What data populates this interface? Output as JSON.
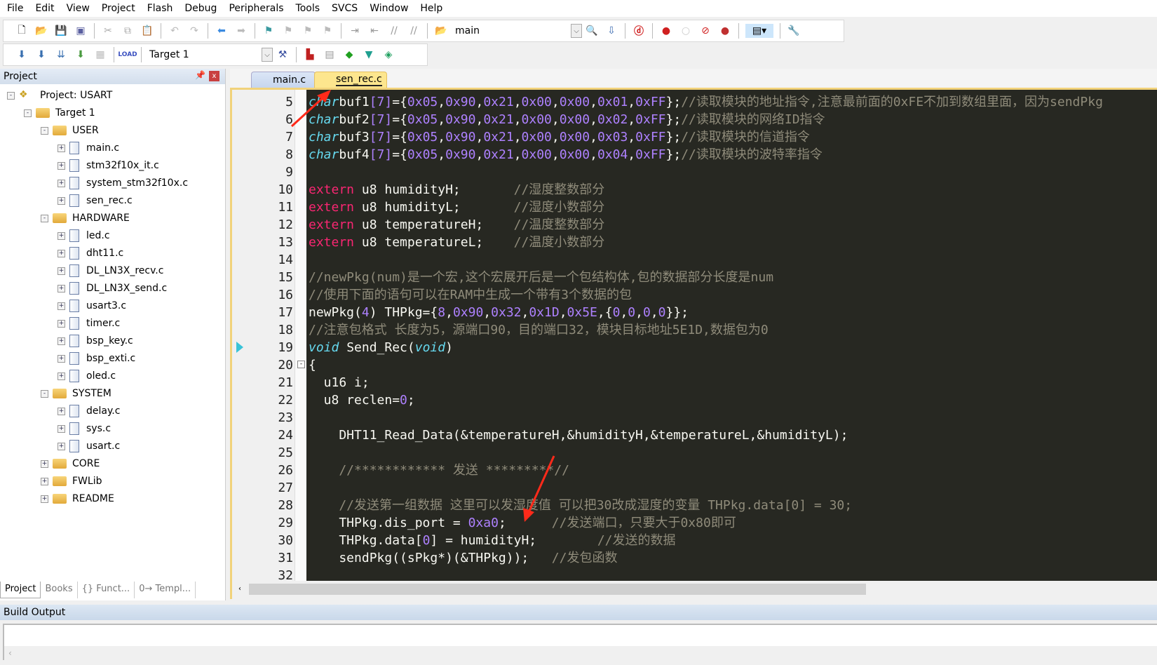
{
  "menu": [
    "File",
    "Edit",
    "View",
    "Project",
    "Flash",
    "Debug",
    "Peripherals",
    "Tools",
    "SVCS",
    "Window",
    "Help"
  ],
  "toolbar1": {
    "combo_value": "main"
  },
  "toolbar2": {
    "target_value": "Target 1"
  },
  "project_panel": {
    "title": "Project",
    "tree": [
      {
        "label": "Project: USART",
        "level": 0,
        "type": "project",
        "exp": "-"
      },
      {
        "label": "Target 1",
        "level": 1,
        "type": "target",
        "exp": "-"
      },
      {
        "label": "USER",
        "level": 2,
        "type": "folder",
        "exp": "-"
      },
      {
        "label": "main.c",
        "level": 3,
        "type": "file",
        "exp": "+"
      },
      {
        "label": "stm32f10x_it.c",
        "level": 3,
        "type": "file",
        "exp": "+"
      },
      {
        "label": "system_stm32f10x.c",
        "level": 3,
        "type": "file",
        "exp": "+"
      },
      {
        "label": "sen_rec.c",
        "level": 3,
        "type": "file",
        "exp": "+"
      },
      {
        "label": "HARDWARE",
        "level": 2,
        "type": "folder",
        "exp": "-"
      },
      {
        "label": "led.c",
        "level": 3,
        "type": "file",
        "exp": "+"
      },
      {
        "label": "dht11.c",
        "level": 3,
        "type": "file",
        "exp": "+"
      },
      {
        "label": "DL_LN3X_recv.c",
        "level": 3,
        "type": "file",
        "exp": "+"
      },
      {
        "label": "DL_LN3X_send.c",
        "level": 3,
        "type": "file",
        "exp": "+"
      },
      {
        "label": "usart3.c",
        "level": 3,
        "type": "file",
        "exp": "+"
      },
      {
        "label": "timer.c",
        "level": 3,
        "type": "file",
        "exp": "+"
      },
      {
        "label": "bsp_key.c",
        "level": 3,
        "type": "file",
        "exp": "+"
      },
      {
        "label": "bsp_exti.c",
        "level": 3,
        "type": "file",
        "exp": "+"
      },
      {
        "label": "oled.c",
        "level": 3,
        "type": "file",
        "exp": "+"
      },
      {
        "label": "SYSTEM",
        "level": 2,
        "type": "folder",
        "exp": "-"
      },
      {
        "label": "delay.c",
        "level": 3,
        "type": "file",
        "exp": "+"
      },
      {
        "label": "sys.c",
        "level": 3,
        "type": "file",
        "exp": "+"
      },
      {
        "label": "usart.c",
        "level": 3,
        "type": "file",
        "exp": "+"
      },
      {
        "label": "CORE",
        "level": 2,
        "type": "folder",
        "exp": "+"
      },
      {
        "label": "FWLib",
        "level": 2,
        "type": "folder",
        "exp": "+"
      },
      {
        "label": "README",
        "level": 2,
        "type": "folder",
        "exp": "+"
      }
    ],
    "tabs": [
      "Project",
      "Books",
      "{} Funct...",
      "0→ Templ..."
    ]
  },
  "editor": {
    "tabs": [
      {
        "label": "main.c",
        "active": false
      },
      {
        "label": "sen_rec.c",
        "active": true
      }
    ],
    "current_line": 19,
    "lines": [
      {
        "n": 5,
        "t": [
          [
            "kw",
            "char"
          ],
          [
            "",
            "buf1"
          ],
          [
            "nu",
            "[7]"
          ],
          [
            "",
            "={"
          ],
          [
            "nu",
            "0x05"
          ],
          [
            "",
            ","
          ],
          [
            "nu",
            "0x90"
          ],
          [
            "",
            ","
          ],
          [
            "nu",
            "0x21"
          ],
          [
            "",
            ","
          ],
          [
            "nu",
            "0x00"
          ],
          [
            "",
            ","
          ],
          [
            "nu",
            "0x00"
          ],
          [
            "",
            ","
          ],
          [
            "nu",
            "0x01"
          ],
          [
            "",
            ","
          ],
          [
            "nu",
            "0xFF"
          ],
          [
            "",
            "};"
          ],
          [
            "cm",
            "//读取模块的地址指令,注意最前面的0xFE不加到数组里面，因为sendPkg"
          ]
        ]
      },
      {
        "n": 6,
        "t": [
          [
            "kw",
            "char"
          ],
          [
            "",
            "buf2"
          ],
          [
            "nu",
            "[7]"
          ],
          [
            "",
            "={"
          ],
          [
            "nu",
            "0x05"
          ],
          [
            "",
            ","
          ],
          [
            "nu",
            "0x90"
          ],
          [
            "",
            ","
          ],
          [
            "nu",
            "0x21"
          ],
          [
            "",
            ","
          ],
          [
            "nu",
            "0x00"
          ],
          [
            "",
            ","
          ],
          [
            "nu",
            "0x00"
          ],
          [
            "",
            ","
          ],
          [
            "nu",
            "0x02"
          ],
          [
            "",
            ","
          ],
          [
            "nu",
            "0xFF"
          ],
          [
            "",
            "};"
          ],
          [
            "cm",
            "//读取模块的网络ID指令"
          ]
        ]
      },
      {
        "n": 7,
        "t": [
          [
            "kw",
            "char"
          ],
          [
            "",
            "buf3"
          ],
          [
            "nu",
            "[7]"
          ],
          [
            "",
            "={"
          ],
          [
            "nu",
            "0x05"
          ],
          [
            "",
            ","
          ],
          [
            "nu",
            "0x90"
          ],
          [
            "",
            ","
          ],
          [
            "nu",
            "0x21"
          ],
          [
            "",
            ","
          ],
          [
            "nu",
            "0x00"
          ],
          [
            "",
            ","
          ],
          [
            "nu",
            "0x00"
          ],
          [
            "",
            ","
          ],
          [
            "nu",
            "0x03"
          ],
          [
            "",
            ","
          ],
          [
            "nu",
            "0xFF"
          ],
          [
            "",
            "};"
          ],
          [
            "cm",
            "//读取模块的信道指令"
          ]
        ]
      },
      {
        "n": 8,
        "t": [
          [
            "kw",
            "char"
          ],
          [
            "",
            "buf4"
          ],
          [
            "nu",
            "[7]"
          ],
          [
            "",
            "={"
          ],
          [
            "nu",
            "0x05"
          ],
          [
            "",
            ","
          ],
          [
            "nu",
            "0x90"
          ],
          [
            "",
            ","
          ],
          [
            "nu",
            "0x21"
          ],
          [
            "",
            ","
          ],
          [
            "nu",
            "0x00"
          ],
          [
            "",
            ","
          ],
          [
            "nu",
            "0x00"
          ],
          [
            "",
            ","
          ],
          [
            "nu",
            "0x04"
          ],
          [
            "",
            ","
          ],
          [
            "nu",
            "0xFF"
          ],
          [
            "",
            "};"
          ],
          [
            "cm",
            "//读取模块的波特率指令"
          ]
        ]
      },
      {
        "n": 9,
        "t": []
      },
      {
        "n": 10,
        "t": [
          [
            "ex",
            "extern"
          ],
          [
            "",
            " u8 humidityH;       "
          ],
          [
            "cm",
            "//湿度整数部分"
          ]
        ]
      },
      {
        "n": 11,
        "t": [
          [
            "ex",
            "extern"
          ],
          [
            "",
            " u8 humidityL;       "
          ],
          [
            "cm",
            "//湿度小数部分"
          ]
        ]
      },
      {
        "n": 12,
        "t": [
          [
            "ex",
            "extern"
          ],
          [
            "",
            " u8 temperatureH;    "
          ],
          [
            "cm",
            "//温度整数部分"
          ]
        ]
      },
      {
        "n": 13,
        "t": [
          [
            "ex",
            "extern"
          ],
          [
            "",
            " u8 temperatureL;    "
          ],
          [
            "cm",
            "//温度小数部分"
          ]
        ]
      },
      {
        "n": 14,
        "t": []
      },
      {
        "n": 15,
        "t": [
          [
            "cm",
            "//newPkg(num)是一个宏,这个宏展开后是一个包结构体,包的数据部分长度是num"
          ]
        ]
      },
      {
        "n": 16,
        "t": [
          [
            "cm",
            "//使用下面的语句可以在RAM中生成一个带有3个数据的包"
          ]
        ]
      },
      {
        "n": 17,
        "t": [
          [
            "",
            "newPkg("
          ],
          [
            "nu",
            "4"
          ],
          [
            "",
            ") THPkg={"
          ],
          [
            "nu",
            "8"
          ],
          [
            "",
            ","
          ],
          [
            "nu",
            "0x90"
          ],
          [
            "",
            ","
          ],
          [
            "nu",
            "0x32"
          ],
          [
            "",
            ","
          ],
          [
            "nu",
            "0x1D"
          ],
          [
            "",
            ","
          ],
          [
            "nu",
            "0x5E"
          ],
          [
            "",
            ",{"
          ],
          [
            "nu",
            "0"
          ],
          [
            "",
            ","
          ],
          [
            "nu",
            "0"
          ],
          [
            "",
            ","
          ],
          [
            "nu",
            "0"
          ],
          [
            "",
            ","
          ],
          [
            "nu",
            "0"
          ],
          [
            "",
            "}};"
          ]
        ]
      },
      {
        "n": 18,
        "t": [
          [
            "cm",
            "//注意包格式 长度为5，源端口90，目的端口32，模块目标地址5E1D,数据包为0"
          ]
        ]
      },
      {
        "n": 19,
        "t": [
          [
            "kw",
            "void"
          ],
          [
            "",
            " Send_Rec("
          ],
          [
            "kw",
            "void"
          ],
          [
            "",
            ")"
          ]
        ]
      },
      {
        "n": 20,
        "t": [
          [
            "",
            "{"
          ]
        ]
      },
      {
        "n": 21,
        "t": [
          [
            "",
            "  u16 i;"
          ]
        ]
      },
      {
        "n": 22,
        "t": [
          [
            "",
            "  u8 reclen="
          ],
          [
            "nu",
            "0"
          ],
          [
            "",
            ";"
          ]
        ]
      },
      {
        "n": 23,
        "t": []
      },
      {
        "n": 24,
        "t": [
          [
            "",
            "    DHT11_Read_Data(&temperatureH,&humidityH,&temperatureL,&humidityL);"
          ]
        ]
      },
      {
        "n": 25,
        "t": []
      },
      {
        "n": 26,
        "t": [
          [
            "cm",
            "    //************ 发送 *********//"
          ]
        ]
      },
      {
        "n": 27,
        "t": []
      },
      {
        "n": 28,
        "t": [
          [
            "cm",
            "    //发送第一组数据 这里可以发湿度值 可以把30改成湿度的变量 THPkg.data[0] = 30;"
          ]
        ]
      },
      {
        "n": 29,
        "t": [
          [
            "",
            "    THPkg.dis_port = "
          ],
          [
            "nu",
            "0xa0"
          ],
          [
            "",
            ";      "
          ],
          [
            "cm",
            "//发送端口，只要大于0x80即可"
          ]
        ]
      },
      {
        "n": 30,
        "t": [
          [
            "",
            "    THPkg.data["
          ],
          [
            "nu",
            "0"
          ],
          [
            "",
            "] = humidityH;        "
          ],
          [
            "cm",
            "//发送的数据"
          ]
        ]
      },
      {
        "n": 31,
        "t": [
          [
            "",
            "    sendPkg((sPkg*)(&THPkg));   "
          ],
          [
            "cm",
            "//发包函数"
          ]
        ]
      },
      {
        "n": 32,
        "t": []
      }
    ]
  },
  "build_output": {
    "title": "Build Output"
  },
  "colors": {
    "background": "#272822",
    "keyword": "#66d9ef",
    "extern": "#f92672",
    "number": "#ae81ff",
    "comment": "#8f8b7a",
    "annotation_arrow": "#ff2a1a"
  }
}
